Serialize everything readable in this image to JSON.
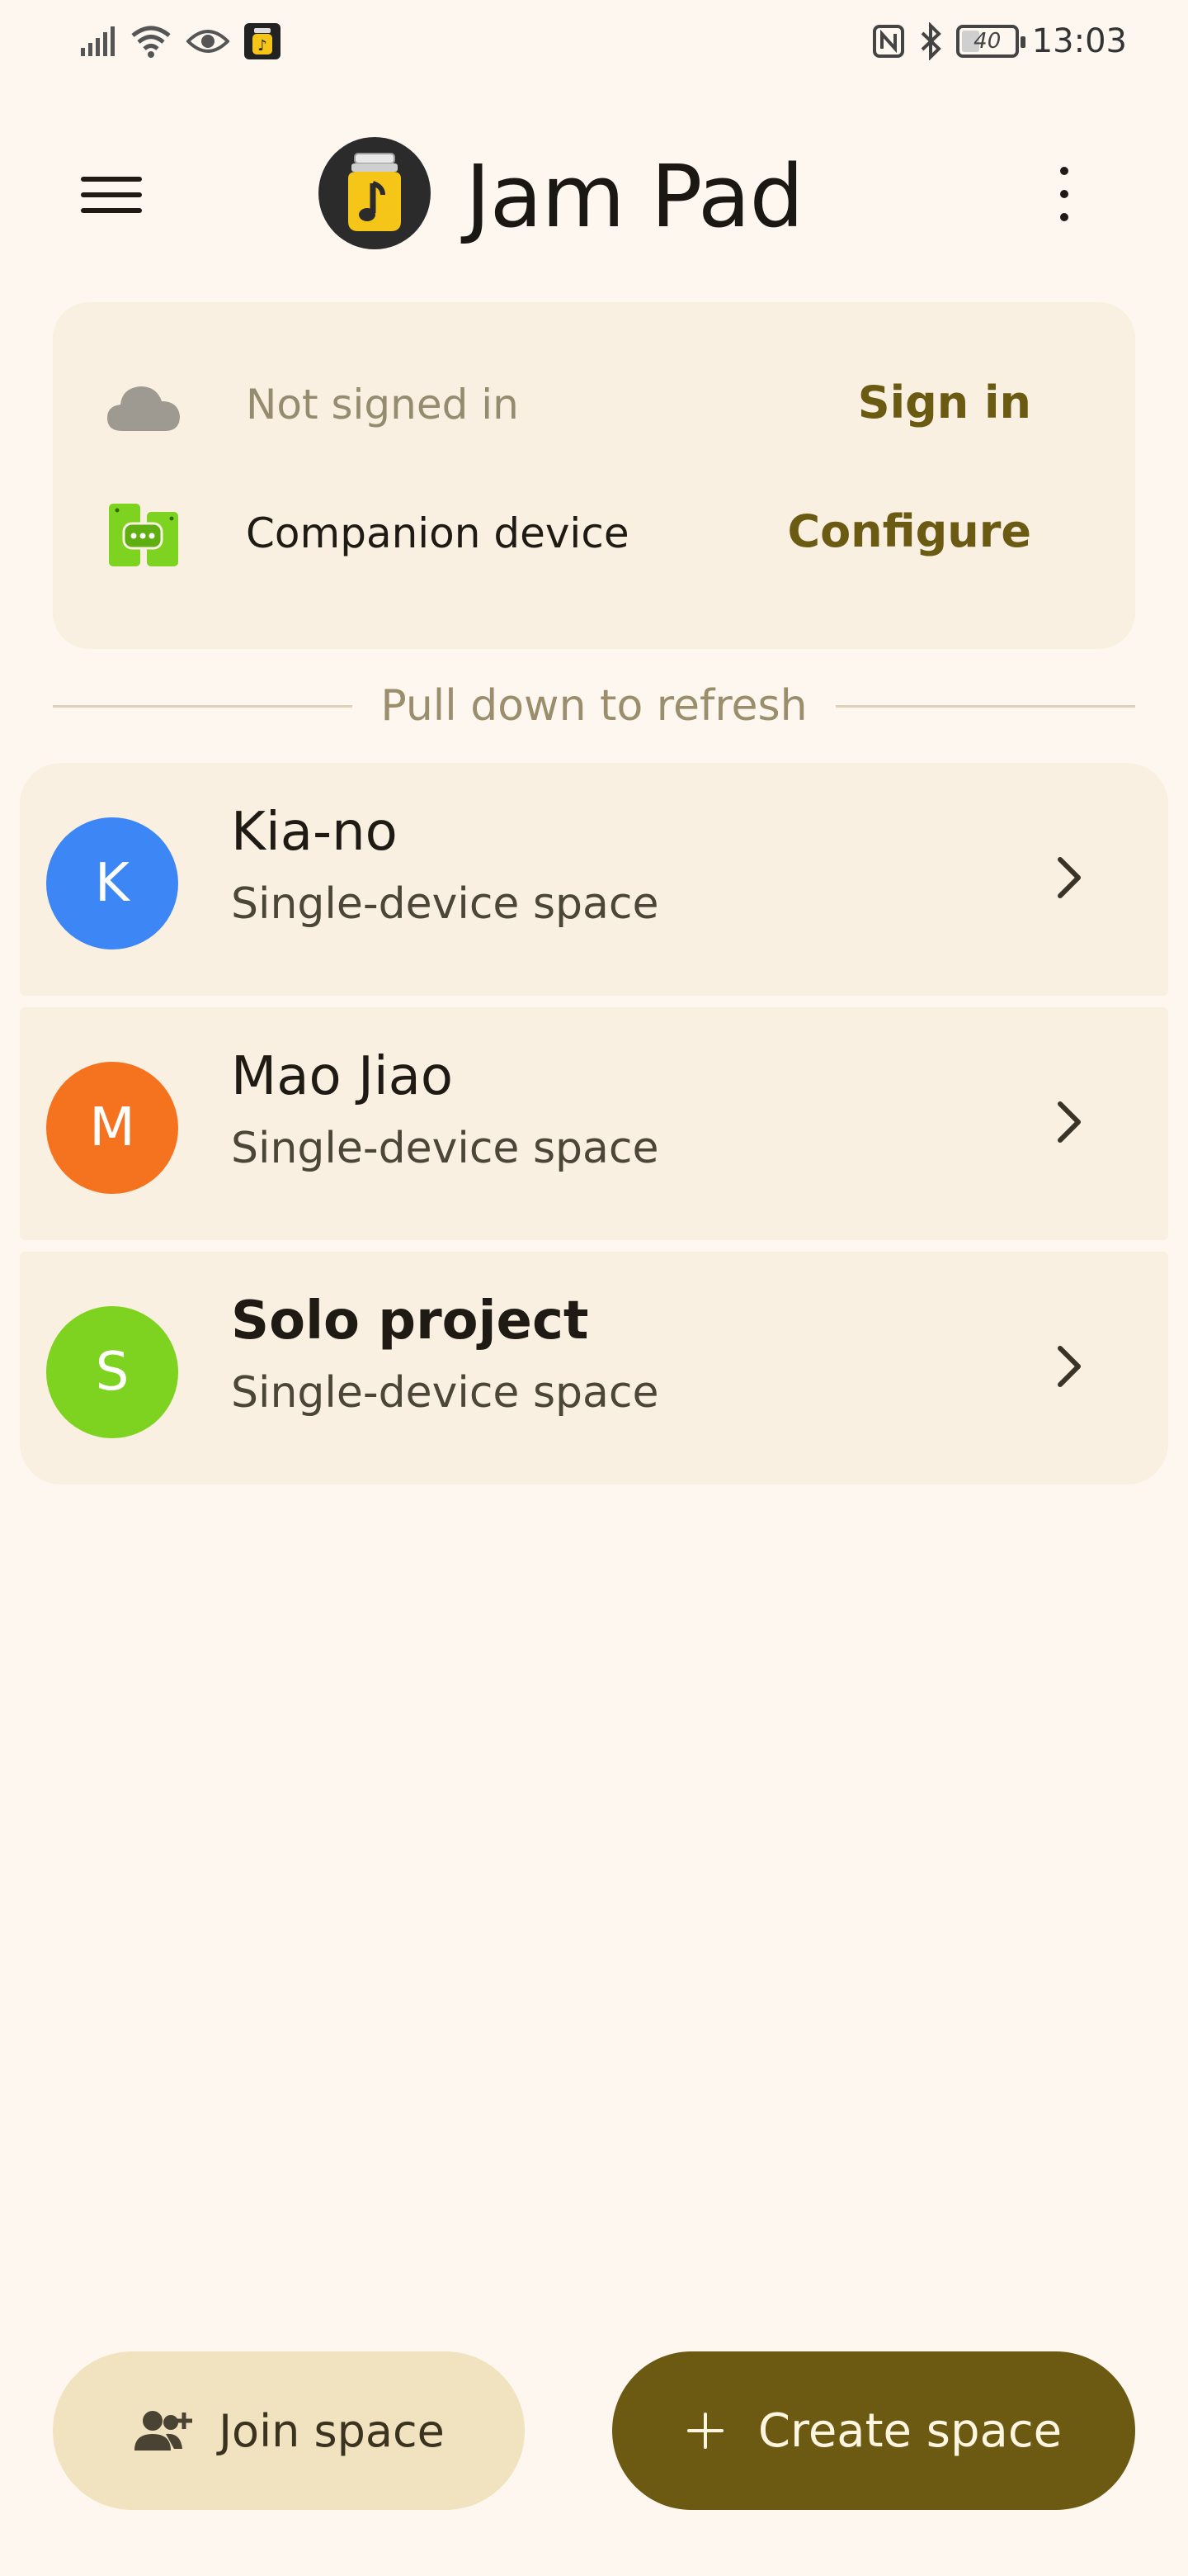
{
  "status_bar": {
    "time": "13:03",
    "battery_percent": "40",
    "battery_level": 0.4,
    "icons": [
      "signal-icon",
      "wifi-icon",
      "eye-icon",
      "jampad-notification-icon",
      "nfc-icon",
      "bluetooth-icon",
      "battery-icon"
    ]
  },
  "app_bar": {
    "title": "Jam Pad",
    "menu_icon": "menu-icon",
    "overflow_icon": "more-vertical-icon"
  },
  "account": {
    "sign_in_status": "Not signed in",
    "sign_in_action": "Sign in",
    "companion_label": "Companion device",
    "companion_action": "Configure",
    "colors": {
      "action": "#6a5a12",
      "muted": "#958b6e",
      "companion_icon": "#7ed321",
      "cloud_icon": "#9e9a92"
    }
  },
  "refresh_hint": "Pull down to refresh",
  "spaces": [
    {
      "initial": "K",
      "name": "Kia-no",
      "subtitle": "Single-device space",
      "color": "#3d86f5",
      "bold": false
    },
    {
      "initial": "M",
      "name": "Mao Jiao",
      "subtitle": "Single-device space",
      "color": "#f5731f",
      "bold": false
    },
    {
      "initial": "S",
      "name": "Solo project",
      "subtitle": "Single-device space",
      "color": "#7ed321",
      "bold": true
    }
  ],
  "actions": {
    "join_label": "Join space",
    "create_label": "Create space",
    "colors": {
      "join_bg": "#f1e3bf",
      "create_bg": "#6d5a12"
    }
  }
}
